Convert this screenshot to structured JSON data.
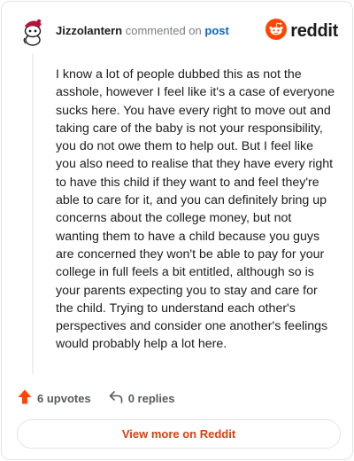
{
  "header": {
    "author": "Jizzolantern",
    "commented_on": "commented on",
    "post_link": "post",
    "brand": "reddit",
    "avatar_icon": "snoo-avatar-icon",
    "brand_icon": "reddit-logo-icon"
  },
  "comment": {
    "text": "I know a lot of people dubbed this as not the asshole, however I feel like it's a case of everyone sucks here. You have every right to move out and taking care of the baby is not your responsibility, you do not owe them to help out. But I feel like you also need to realise that they have every right to have this child if they want to and feel they're able to care for it, and you can definitely bring up concerns about the college money, but not wanting them to have a child because you guys are concerned they won't be able to pay for your college in full feels a bit entitled, although so is your parents expecting you to stay and care for the child. Trying to understand each other's perspectives and consider one another's feelings would probably help a lot here."
  },
  "actions": {
    "upvotes": "6 upvotes",
    "replies": "0 replies",
    "upvote_icon": "upvote-arrow-icon",
    "reply_icon": "reply-icon"
  },
  "footer": {
    "view_more": "View more on Reddit"
  },
  "colors": {
    "brand_orange": "#ff4500",
    "link_blue": "#0a64c8",
    "view_more_text": "#d8400e",
    "muted": "#7a7d80"
  }
}
